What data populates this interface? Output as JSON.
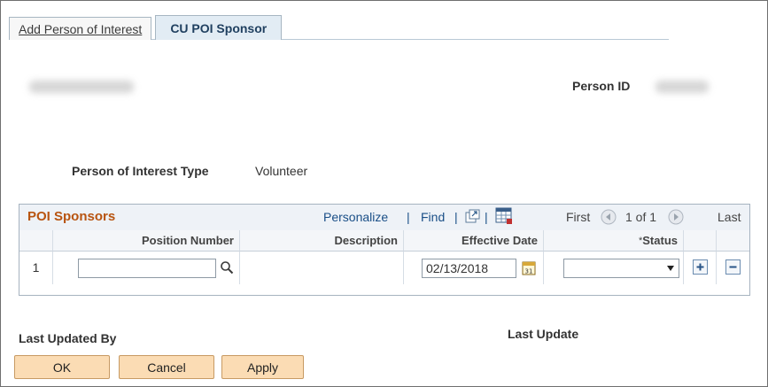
{
  "tabs": [
    {
      "label": "Add Person of Interest",
      "active": false
    },
    {
      "label": "CU POI Sponsor",
      "active": true
    }
  ],
  "person": {
    "id_label": "Person ID",
    "poi_type_label": "Person of Interest Type",
    "poi_type_value": "Volunteer"
  },
  "grid": {
    "title": "POI Sponsors",
    "personalize": "Personalize",
    "find": "Find",
    "first": "First",
    "page_info": "1 of 1",
    "last": "Last",
    "columns": {
      "position_number": "Position Number",
      "description": "Description",
      "effective_date": "Effective Date",
      "status_required": "*",
      "status": "Status"
    },
    "rows": [
      {
        "number": "1",
        "position_number": "",
        "description": "",
        "effective_date": "02/13/2018",
        "status": ""
      }
    ]
  },
  "footer": {
    "last_updated_by": "Last Updated By",
    "last_update": "Last Update"
  },
  "buttons": {
    "ok": "OK",
    "cancel": "Cancel",
    "apply": "Apply"
  },
  "colors": {
    "grid_title": "#b85410",
    "link": "#1a4f87",
    "button_bg": "#fbdcb4",
    "active_tab_bg": "#e2ecf4"
  }
}
